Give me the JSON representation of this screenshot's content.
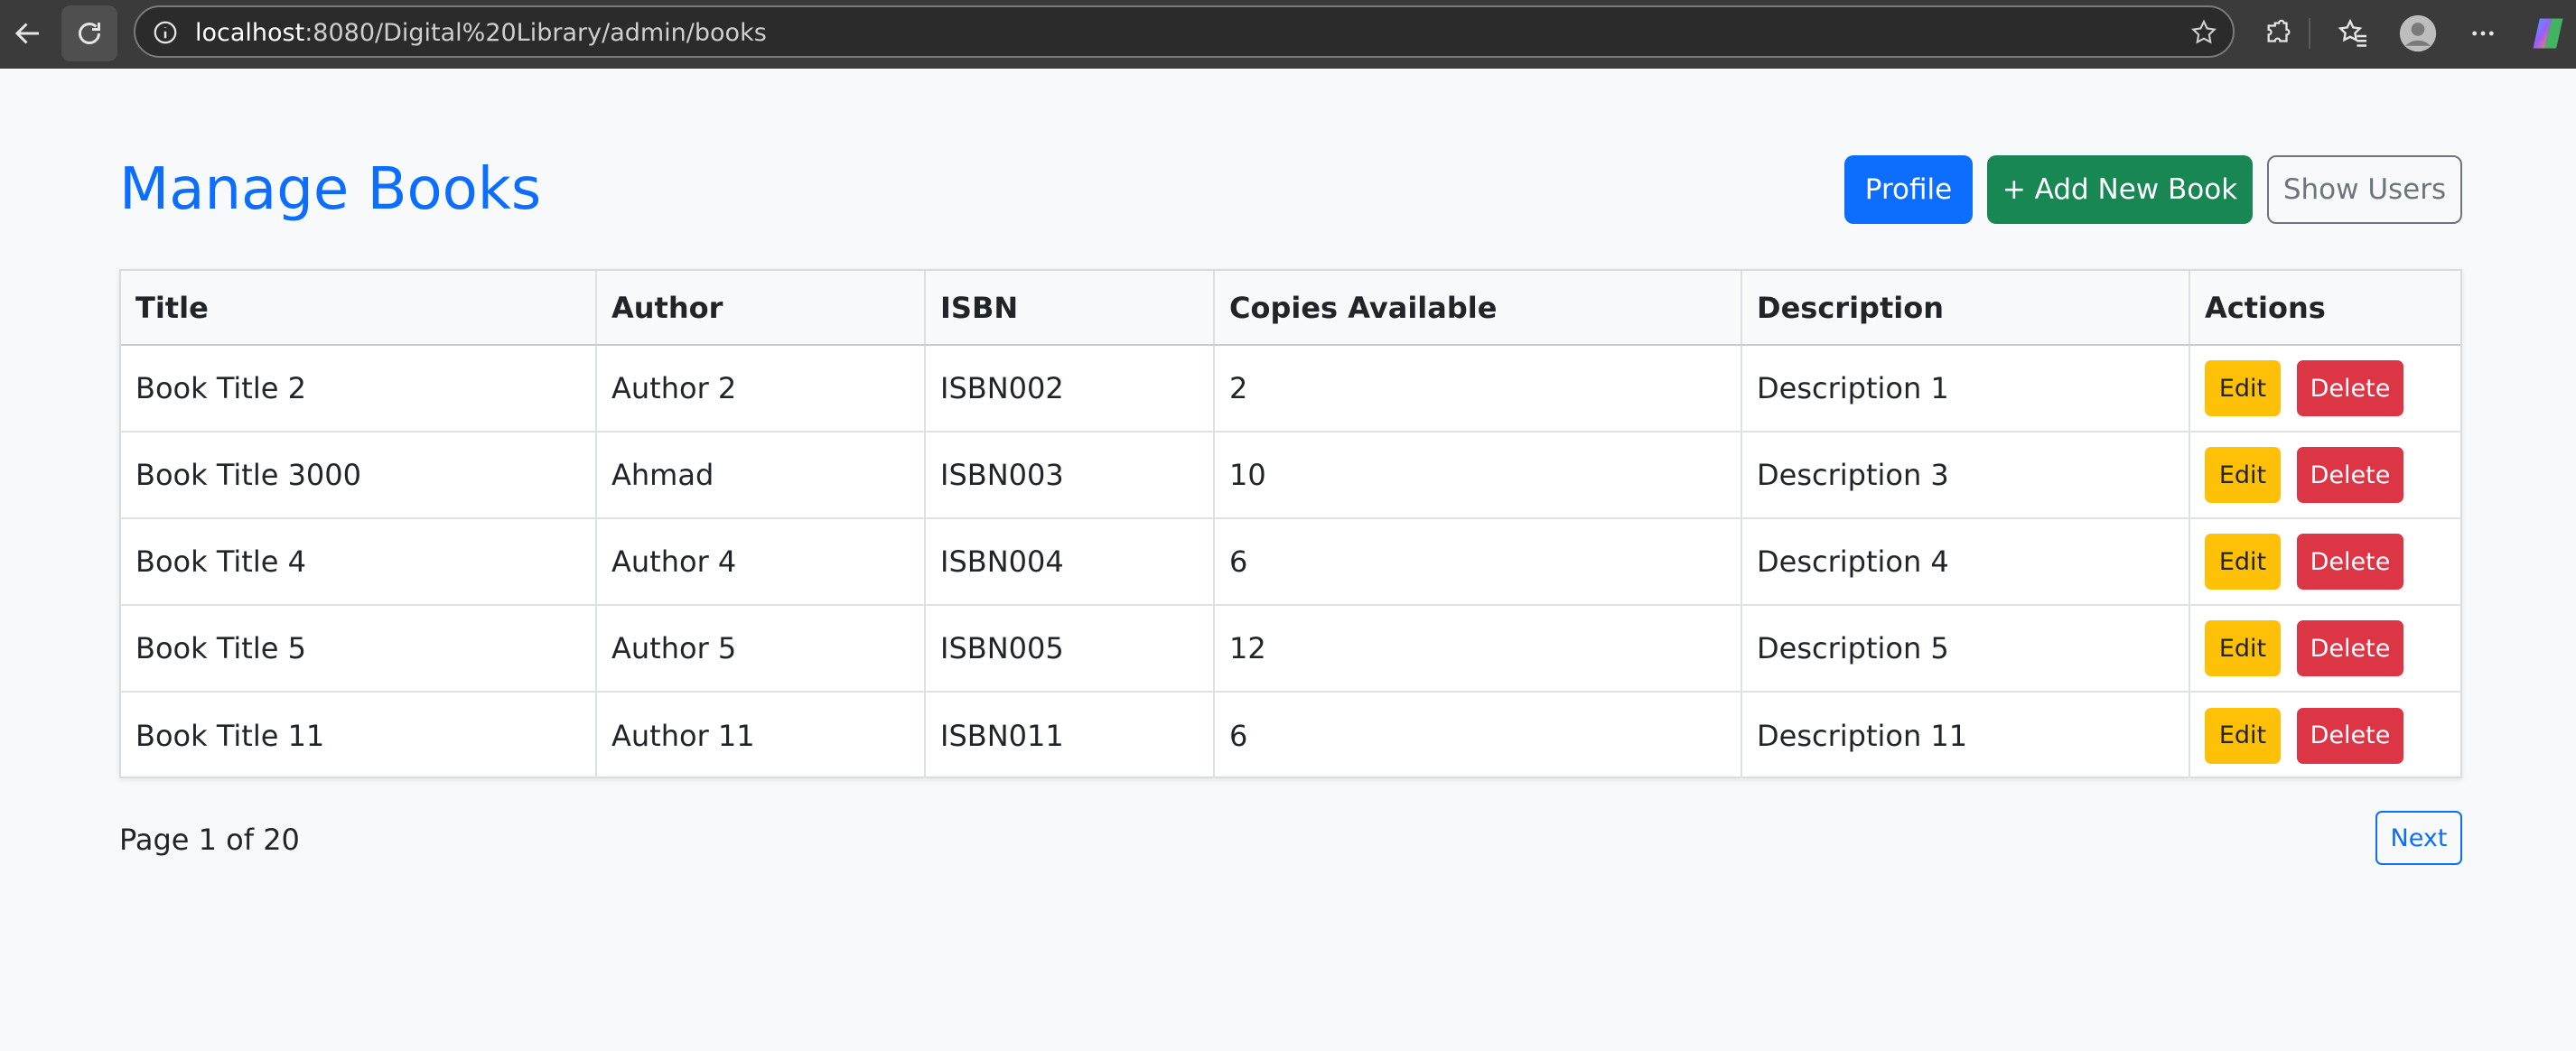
{
  "browser": {
    "url_host": "localhost",
    "url_rest": ":8080/Digital%20Library/admin/books"
  },
  "header": {
    "title": "Manage Books",
    "profile_label": "Profile",
    "add_label": "+ Add New Book",
    "users_label": "Show Users"
  },
  "table": {
    "columns": [
      "Title",
      "Author",
      "ISBN",
      "Copies Available",
      "Description",
      "Actions"
    ],
    "rows": [
      {
        "title": "Book Title 2",
        "author": "Author 2",
        "isbn": "ISBN002",
        "copies": "2",
        "description": "Description 1"
      },
      {
        "title": "Book Title 3000",
        "author": "Ahmad",
        "isbn": "ISBN003",
        "copies": "10",
        "description": "Description 3"
      },
      {
        "title": "Book Title 4",
        "author": "Author 4",
        "isbn": "ISBN004",
        "copies": "6",
        "description": "Description 4"
      },
      {
        "title": "Book Title 5",
        "author": "Author 5",
        "isbn": "ISBN005",
        "copies": "12",
        "description": "Description 5"
      },
      {
        "title": "Book Title 11",
        "author": "Author 11",
        "isbn": "ISBN011",
        "copies": "6",
        "description": "Description 11"
      }
    ],
    "edit_label": "Edit",
    "delete_label": "Delete"
  },
  "pagination": {
    "status": "Page 1 of 20",
    "next_label": "Next"
  },
  "icons": {
    "back": "back-arrow-icon",
    "reload": "reload-icon",
    "info": "info-icon",
    "star": "star-icon",
    "extensions": "puzzle-icon",
    "favorites": "favorites-icon",
    "profile": "avatar-icon",
    "menu": "more-icon",
    "copilot": "copilot-icon"
  },
  "colors": {
    "primary": "#0d6efd",
    "success": "#198754",
    "warning": "#ffc107",
    "danger": "#dc3545",
    "secondary": "#6c757d"
  }
}
